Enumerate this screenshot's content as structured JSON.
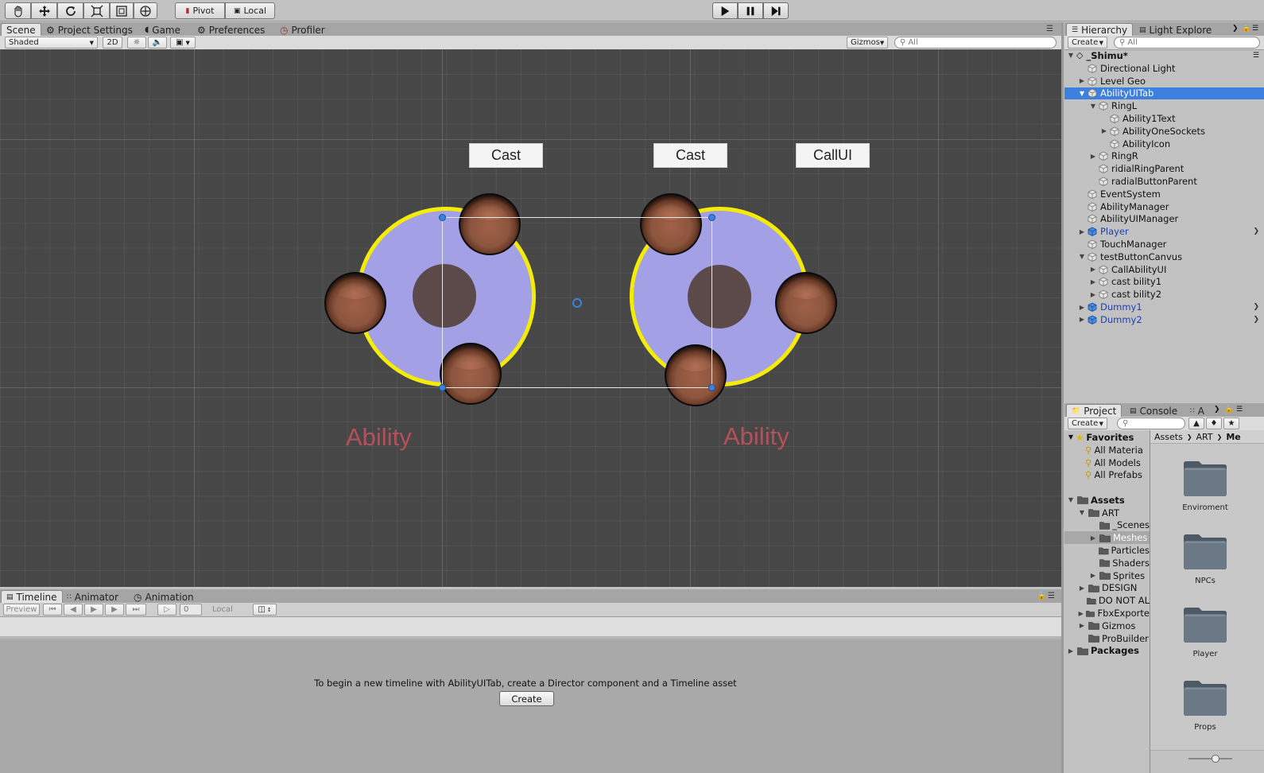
{
  "toolbar": {
    "pivot_label": "Pivot",
    "local_label": "Local",
    "tools": [
      "hand-icon",
      "move-icon",
      "rotate-icon",
      "scale-icon",
      "rect-icon",
      "transform-icon"
    ]
  },
  "scene_tabs": {
    "tabs": [
      "Scene",
      "Project Settings",
      "Game",
      "Preferences",
      "Profiler"
    ],
    "active": "Scene"
  },
  "scene_toolbar": {
    "shading_mode": "Shaded",
    "mode_2d": "2D",
    "gizmos_label": "Gizmos",
    "search_placeholder": "All"
  },
  "scene_view": {
    "buttons": [
      "Cast",
      "Cast",
      "CallUI"
    ],
    "ability_labels": [
      "Ability",
      "Ability"
    ],
    "colors": {
      "ring_fill": "#a3a0e6",
      "ring_border": "#f4ec08",
      "hub": "#5c4a4a",
      "ability_text": "#b5505a"
    }
  },
  "bottom_tabs": {
    "tabs": [
      "Timeline",
      "Animator",
      "Animation"
    ],
    "active": "Timeline",
    "preview_label": "Preview",
    "frame_value": "0",
    "local_label": "Local"
  },
  "timeline": {
    "message": "To begin a new timeline with AbilityUITab, create a Director component and a Timeline asset",
    "create_button": "Create"
  },
  "hierarchy": {
    "tabs": [
      "Hierarchy",
      "Light Explore"
    ],
    "create_label": "Create",
    "search_placeholder": "All",
    "scene_name": "_Shimu*",
    "items": [
      {
        "label": "Directional Light",
        "indent": 1,
        "arrow": "",
        "prefab": false
      },
      {
        "label": "Level Geo",
        "indent": 1,
        "arrow": "right",
        "prefab": false
      },
      {
        "label": "AbilityUITab",
        "indent": 1,
        "arrow": "down",
        "prefab": false,
        "selected": true
      },
      {
        "label": "RingL",
        "indent": 2,
        "arrow": "down",
        "prefab": false
      },
      {
        "label": "Ability1Text",
        "indent": 3,
        "arrow": "",
        "prefab": false
      },
      {
        "label": "AbilityOneSockets",
        "indent": 3,
        "arrow": "right",
        "prefab": false
      },
      {
        "label": "AbilityIcon",
        "indent": 3,
        "arrow": "",
        "prefab": false
      },
      {
        "label": "RingR",
        "indent": 2,
        "arrow": "right",
        "prefab": false
      },
      {
        "label": "ridialRingParent",
        "indent": 2,
        "arrow": "",
        "prefab": false
      },
      {
        "label": "radialButtonParent",
        "indent": 2,
        "arrow": "",
        "prefab": false
      },
      {
        "label": "EventSystem",
        "indent": 1,
        "arrow": "",
        "prefab": false
      },
      {
        "label": "AbilityManager",
        "indent": 1,
        "arrow": "",
        "prefab": false
      },
      {
        "label": "AbilityUIManager",
        "indent": 1,
        "arrow": "",
        "prefab": false
      },
      {
        "label": "Player",
        "indent": 1,
        "arrow": "right",
        "prefab": true,
        "chevron": true
      },
      {
        "label": "TouchManager",
        "indent": 1,
        "arrow": "",
        "prefab": false
      },
      {
        "label": "testButtonCanvus",
        "indent": 1,
        "arrow": "down",
        "prefab": false
      },
      {
        "label": "CallAbilityUI",
        "indent": 2,
        "arrow": "right",
        "prefab": false
      },
      {
        "label": "cast bility1",
        "indent": 2,
        "arrow": "right",
        "prefab": false
      },
      {
        "label": "cast bility2",
        "indent": 2,
        "arrow": "right",
        "prefab": false
      },
      {
        "label": "Dummy1",
        "indent": 1,
        "arrow": "right",
        "prefab": true,
        "chevron": true
      },
      {
        "label": "Dummy2",
        "indent": 1,
        "arrow": "right",
        "prefab": true,
        "chevron": true
      }
    ]
  },
  "project": {
    "tabs": [
      "Project",
      "Console",
      "A"
    ],
    "create_label": "Create",
    "breadcrumb": [
      "Assets",
      "ART",
      "Me"
    ],
    "favorites_label": "Favorites",
    "favorites": [
      "All Materia",
      "All Models",
      "All Prefabs"
    ],
    "tree": [
      {
        "label": "Assets",
        "indent": 0,
        "arrow": "down",
        "bold": true
      },
      {
        "label": "ART",
        "indent": 1,
        "arrow": "down"
      },
      {
        "label": "_Scenes",
        "indent": 2,
        "arrow": ""
      },
      {
        "label": "Meshes",
        "indent": 2,
        "arrow": "right",
        "selected": true
      },
      {
        "label": "Particles",
        "indent": 2,
        "arrow": ""
      },
      {
        "label": "Shaders",
        "indent": 2,
        "arrow": ""
      },
      {
        "label": "Sprites",
        "indent": 2,
        "arrow": "right"
      },
      {
        "label": "DESIGN",
        "indent": 1,
        "arrow": "right"
      },
      {
        "label": "DO NOT AL",
        "indent": 1,
        "arrow": ""
      },
      {
        "label": "FbxExporte",
        "indent": 1,
        "arrow": "right"
      },
      {
        "label": "Gizmos",
        "indent": 1,
        "arrow": "right"
      },
      {
        "label": "ProBuilder",
        "indent": 1,
        "arrow": ""
      },
      {
        "label": "Packages",
        "indent": 0,
        "arrow": "right",
        "bold": true
      }
    ],
    "folders": [
      "Enviroment",
      "NPCs",
      "Player",
      "Props"
    ]
  }
}
